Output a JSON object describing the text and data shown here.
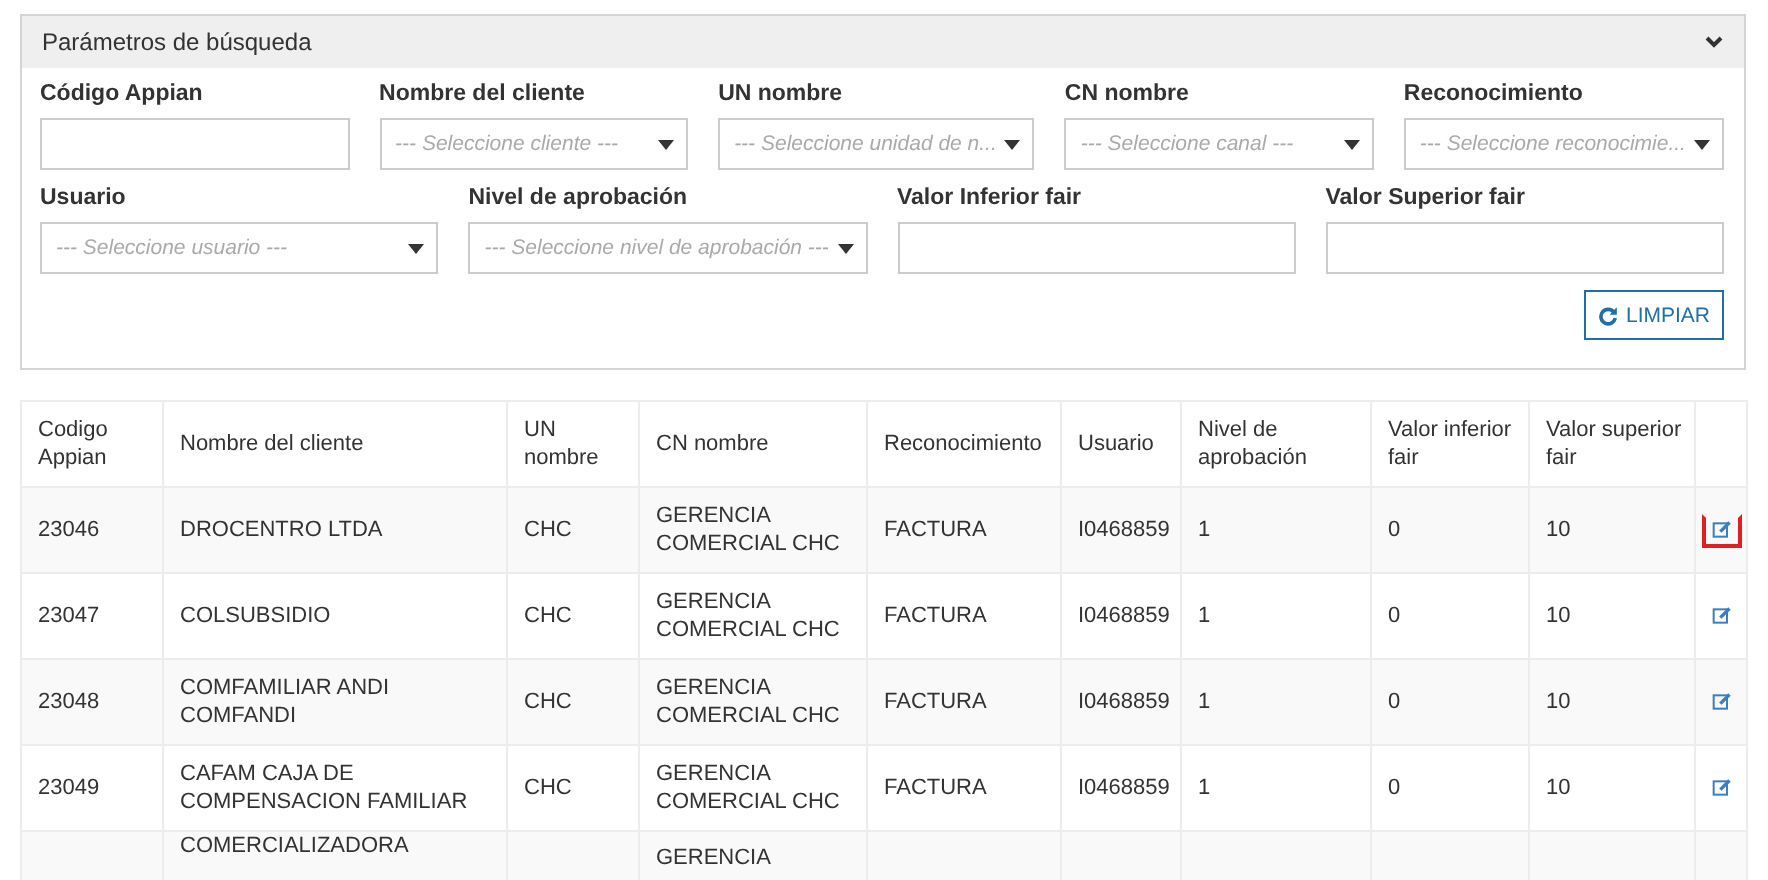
{
  "search_panel": {
    "title": "Parámetros de búsqueda",
    "expanded": true,
    "filters": [
      {
        "label": "Código Appian",
        "kind": "text"
      },
      {
        "label": "Nombre del cliente",
        "kind": "select",
        "placeholder": "--- Seleccione cliente ---"
      },
      {
        "label": "UN nombre",
        "kind": "select",
        "placeholder": "--- Seleccione unidad de n..."
      },
      {
        "label": "CN nombre",
        "kind": "select",
        "placeholder": "--- Seleccione canal ---"
      },
      {
        "label": "Reconocimiento",
        "kind": "select",
        "placeholder": "--- Seleccione reconocimie..."
      },
      {
        "label": "Usuario",
        "kind": "select",
        "placeholder": "--- Seleccione usuario ---"
      },
      {
        "label": "Nivel de aprobación",
        "kind": "select",
        "placeholder": "--- Seleccione nivel de aprobación ---"
      },
      {
        "label": "Valor Inferior fair",
        "kind": "text"
      },
      {
        "label": "Valor Superior fair",
        "kind": "text"
      }
    ],
    "clear_button": "LIMPIAR"
  },
  "table": {
    "columns": [
      "Codigo Appian",
      "Nombre del cliente",
      "UN nombre",
      "CN nombre",
      "Reconocimiento",
      "Usuario",
      "Nivel de aprobación",
      "Valor inferior fair",
      "Valor superior fair"
    ],
    "rows": [
      {
        "cells": [
          "23046",
          "DROCENTRO LTDA",
          "CHC",
          "GERENCIA COMERCIAL CHC",
          "FACTURA",
          "I0468859",
          "1",
          "0",
          "10"
        ],
        "highlighted": true
      },
      {
        "cells": [
          "23047",
          "COLSUBSIDIO",
          "CHC",
          "GERENCIA COMERCIAL CHC",
          "FACTURA",
          "I0468859",
          "1",
          "0",
          "10"
        ],
        "highlighted": false
      },
      {
        "cells": [
          "23048",
          "COMFAMILIAR ANDI COMFANDI",
          "CHC",
          "GERENCIA COMERCIAL CHC",
          "FACTURA",
          "I0468859",
          "1",
          "0",
          "10"
        ],
        "highlighted": false
      },
      {
        "cells": [
          "23049",
          "CAFAM CAJA DE COMPENSACION FAMILIAR",
          "CHC",
          "GERENCIA COMERCIAL CHC",
          "FACTURA",
          "I0468859",
          "1",
          "0",
          "10"
        ],
        "highlighted": false
      },
      {
        "cells": [
          null,
          "COMERCIALIZADORA",
          null,
          "GERENCIA",
          null,
          null,
          null,
          null,
          null
        ]
      }
    ]
  }
}
